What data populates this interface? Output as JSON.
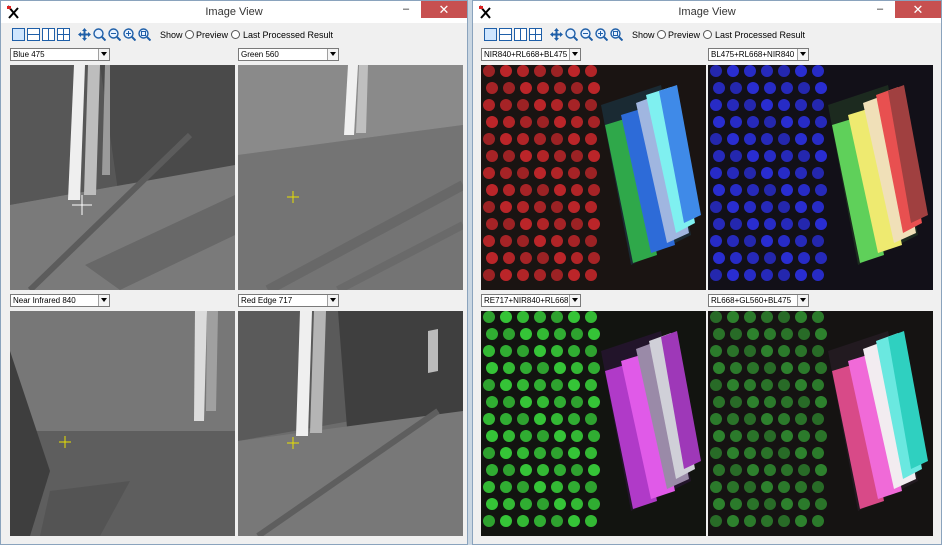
{
  "left_window": {
    "title": "Image View",
    "controls": {
      "minimize": "–",
      "maximize": "☐",
      "close": "✕"
    },
    "toolbar": {
      "show_label": "Show",
      "preview_label": "Preview",
      "last_processed_label": "Last Processed Result"
    },
    "panels": [
      {
        "band": "Blue 475"
      },
      {
        "band": "Green 560"
      },
      {
        "band": "Near Infrared 840"
      },
      {
        "band": "Red Edge 717"
      }
    ]
  },
  "right_window": {
    "title": "Image View",
    "controls": {
      "minimize": "–",
      "maximize": "☐",
      "close": "✕"
    },
    "toolbar": {
      "show_label": "Show",
      "preview_label": "Preview",
      "last_processed_label": "Last Processed Result"
    },
    "panels": [
      {
        "composite": "NIR840+RL668+BL475"
      },
      {
        "composite": "BL475+RL668+NIR840"
      },
      {
        "composite": "RE717+NIR840+RL668"
      },
      {
        "composite": "RL668+GL560+BL475"
      }
    ]
  },
  "colors": {
    "title_bar": "#ffffff",
    "window_bg": "#f0f0f0",
    "close_button": "#c75050",
    "tool_icon": "#1f5fa8",
    "crosshair": "#e8e000"
  },
  "icons": [
    "app-logo-icon",
    "view-single-icon",
    "view-split-h-icon",
    "view-split-v-icon",
    "view-quad-icon",
    "pan-icon",
    "zoom-1-icon",
    "zoom-2-icon",
    "zoom-3-icon",
    "zoom-fit-icon"
  ]
}
